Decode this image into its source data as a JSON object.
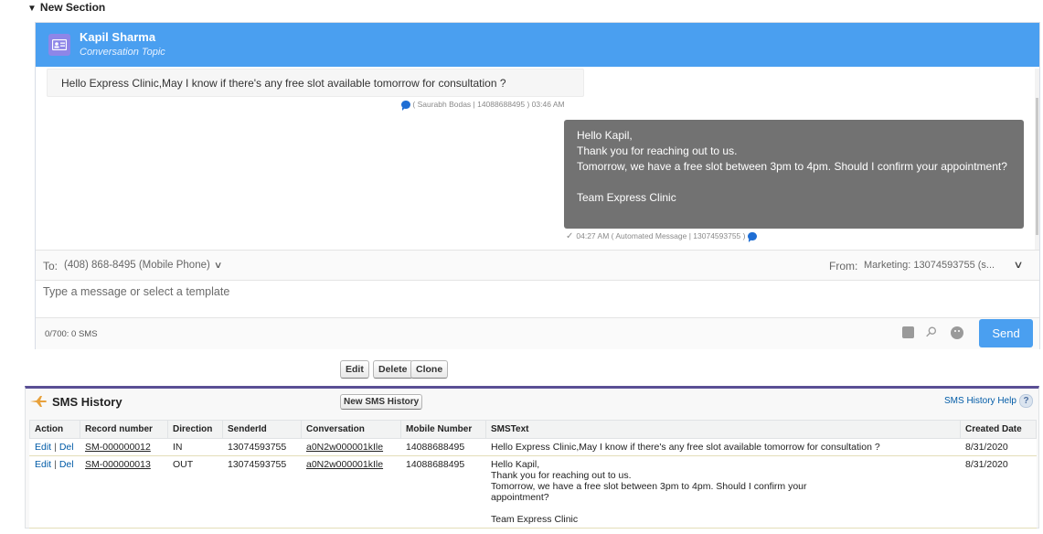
{
  "section": {
    "title": "New Section"
  },
  "chat": {
    "contact_name": "Kapil Sharma",
    "contact_subtitle": "Conversation Topic",
    "incoming": {
      "text": "Hello Express Clinic,May I know if there's any free slot available tomorrow for consultation ?",
      "meta": "( Saurabh Bodas | 14088688495 ) 03:46 AM"
    },
    "outgoing": {
      "text": "Hello Kapil,\nThank you for reaching out to us.\nTomorrow, we have a free slot between 3pm to 4pm. Should I confirm your appointment?\n\nTeam Express Clinic",
      "meta": "04:27 AM  ( Automated Message | 13074593755 )"
    },
    "to_label": "To:",
    "to_value": "(408) 868-8495 (Mobile Phone)",
    "from_label": "From:",
    "from_value": "Marketing: 13074593755 (s...",
    "input_placeholder": "Type a message or select a template",
    "counter": "0/700: 0 SMS",
    "send_label": "Send"
  },
  "detail_buttons": {
    "edit": "Edit",
    "delete": "Delete",
    "clone": "Clone"
  },
  "related_list": {
    "title": "SMS History",
    "new_button": "New SMS History",
    "help_link": "SMS History Help",
    "help_icon": "?",
    "columns": [
      "Action",
      "Record number",
      "Direction",
      "SenderId",
      "Conversation",
      "Mobile Number",
      "SMSText",
      "Created Date"
    ],
    "rows": [
      {
        "edit": "Edit",
        "del": "Del",
        "record": "SM-000000012",
        "direction": "IN",
        "sender": "13074593755",
        "conversation": "a0N2w000001kIle",
        "mobile": "14088688495",
        "text": "Hello Express Clinic,May I know if there's any free slot available tomorrow for consultation ?",
        "created": "8/31/2020"
      },
      {
        "edit": "Edit",
        "del": "Del",
        "record": "SM-000000013",
        "direction": "OUT",
        "sender": "13074593755",
        "conversation": "a0N2w000001kIle",
        "mobile": "14088688495",
        "text": "Hello Kapil,\nThank you for reaching out to us.\nTomorrow, we have a free slot between 3pm to 4pm. Should I confirm your\nappointment?\n\nTeam Express Clinic",
        "created": "8/31/2020"
      }
    ]
  },
  "colors": {
    "header_blue": "#4a9ff0",
    "outgoing_bubble": "#727272",
    "related_border": "#5a4f95"
  }
}
